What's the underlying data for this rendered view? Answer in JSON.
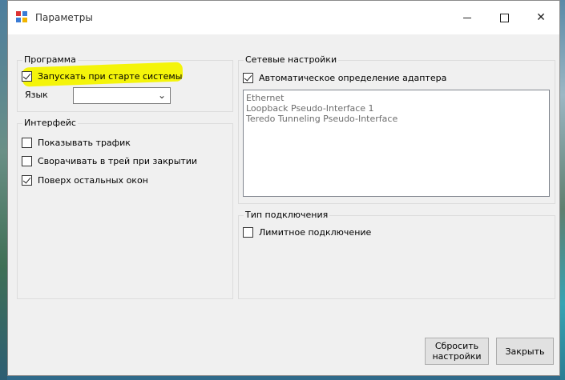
{
  "window": {
    "title": "Параметры"
  },
  "program": {
    "group_title": "Программа",
    "autostart_label": "Запускать при старте системы",
    "autostart_checked": true,
    "language_label": "Язык",
    "language_value": ""
  },
  "interface": {
    "group_title": "Интерфейс",
    "show_traffic_label": "Показывать трафик",
    "show_traffic_checked": false,
    "minimize_to_tray_label": "Сворачивать в трей при закрытии",
    "minimize_to_tray_checked": false,
    "always_on_top_label": "Поверх остальных окон",
    "always_on_top_checked": true
  },
  "network": {
    "group_title": "Сетевые настройки",
    "auto_detect_label": "Автоматическое определение адаптера",
    "auto_detect_checked": true,
    "adapters": [
      "Ethernet",
      "Loopback Pseudo-Interface 1",
      "Teredo Tunneling Pseudo-Interface"
    ]
  },
  "connection": {
    "group_title": "Тип подключения",
    "metered_label": "Лимитное подключение",
    "metered_checked": false
  },
  "buttons": {
    "reset_label": "Сбросить\nнастройки",
    "close_label": "Закрыть"
  },
  "colors": {
    "highlight": "#f4f40a",
    "window_bg": "#f0f0f0"
  }
}
